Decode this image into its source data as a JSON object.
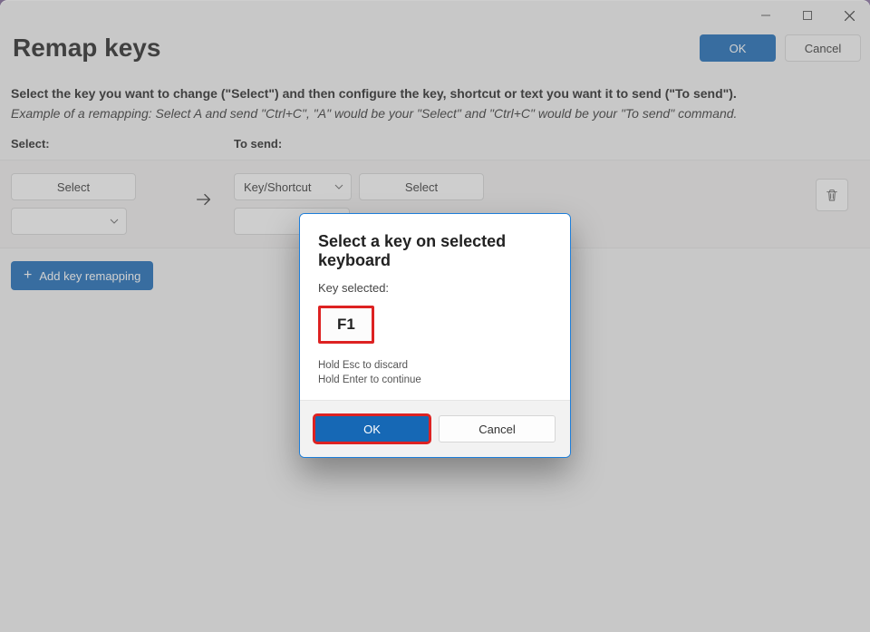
{
  "page_title": "Remap keys",
  "header": {
    "ok": "OK",
    "cancel": "Cancel"
  },
  "instructions": {
    "line1": "Select the key you want to change (\"Select\") and then configure the key, shortcut or text you want it to send (\"To send\").",
    "line2": "Example of a remapping: Select A and send \"Ctrl+C\", \"A\" would be your \"Select\" and \"Ctrl+C\" would be your \"To send\" command."
  },
  "columns": {
    "select": "Select:",
    "to_send": "To send:"
  },
  "band": {
    "left_select": "Select",
    "dropdown_empty": "",
    "right_mode": "Key/Shortcut",
    "right_select": "Select"
  },
  "add_button": "Add key remapping",
  "dialog": {
    "title": "Select a key on selected keyboard",
    "label": "Key selected:",
    "key": "F1",
    "hint1": "Hold Esc to discard",
    "hint2": "Hold Enter to continue",
    "ok": "OK",
    "cancel": "Cancel"
  }
}
